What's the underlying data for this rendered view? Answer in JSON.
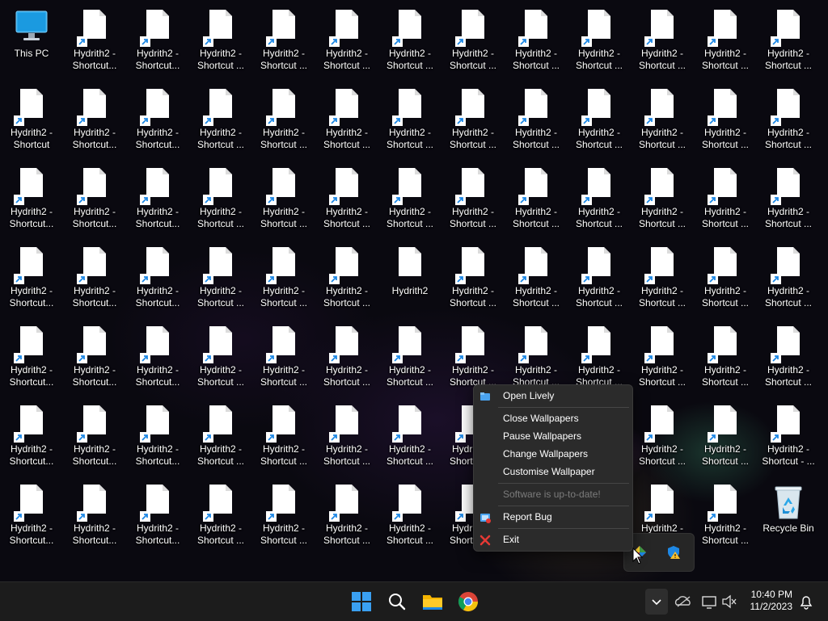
{
  "desktop": {
    "this_pc_label": "This PC",
    "recycle_bin_label": "Recycle Bin",
    "hydrith2_label": "Hydrith2",
    "shortcut_label_a": "Hydrith2 -\nShortcut...",
    "shortcut_label_b": "Hydrith2 -\nShortcut ...",
    "shortcut_label_c": "Hydrith2 -\nShortcut",
    "shortcut_label_d": "Hydrith2 -\nShortcut - ..."
  },
  "context_menu": {
    "items": [
      {
        "label": "Open Lively",
        "icon": "lively-folder-icon"
      },
      {
        "label": "Close Wallpapers"
      },
      {
        "label": "Pause Wallpapers"
      },
      {
        "label": "Change Wallpapers"
      },
      {
        "label": "Customise Wallpaper"
      },
      {
        "label": "Software is up-to-date!",
        "disabled": true
      },
      {
        "label": "Report Bug",
        "icon": "bug-report-icon"
      },
      {
        "label": "Exit",
        "icon": "exit-x-icon"
      }
    ]
  },
  "tray_overflow": {
    "icons": [
      "lively-tray-icon",
      "security-warning-icon"
    ]
  },
  "taskbar": {
    "time": "10:40 PM",
    "date": "11/2/2023",
    "pinned": [
      "windows-start-icon",
      "search-icon",
      "file-explorer-icon",
      "chrome-icon"
    ],
    "tray": [
      "chevron-up-icon",
      "onedrive-icon",
      "network-icon",
      "volume-muted-icon"
    ],
    "colors": {
      "accent": "#0078d4",
      "taskbar_bg": "#1c1c1c",
      "menu_bg": "#2b2b2b"
    }
  }
}
